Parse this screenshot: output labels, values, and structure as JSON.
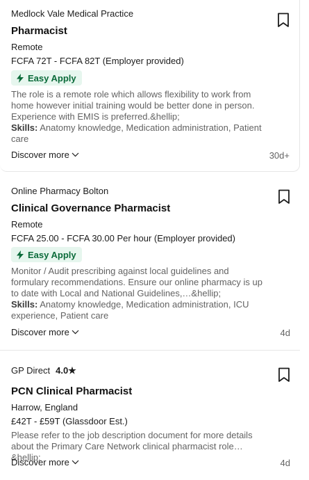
{
  "jobs": [
    {
      "company": "Medlock Vale Medical Practice",
      "rating": "",
      "title": "Pharmacist",
      "location": "Remote",
      "salary": "FCFA 72T - FCFA 82T (Employer provided)",
      "easy_apply": "Easy Apply",
      "description": "The role is a remote role which allows flexibility to work from home however initial training would be better done in person. Experience with EMIS is preferred.&hellip;",
      "skills_label": "Skills:",
      "skills": " Anatomy knowledge, Medication administration, Patient care",
      "discover": "Discover more",
      "age": "30d+"
    },
    {
      "company": "Online Pharmacy Bolton",
      "rating": "",
      "title": "Clinical Governance Pharmacist",
      "location": "Remote",
      "salary": "FCFA 25.00 - FCFA 30.00 Per hour (Employer provided)",
      "easy_apply": "Easy Apply",
      "description": "Monitor / Audit prescribing against local guidelines and formulary recommendations. Ensure our online pharmacy is up to date with Local and National Guidelines,…&hellip;",
      "skills_label": "Skills:",
      "skills": " Anatomy knowledge, Medication administration, ICU experience, Patient care",
      "discover": "Discover more",
      "age": "4d"
    },
    {
      "company": "GP Direct",
      "rating": "4.0★",
      "title": "PCN Clinical Pharmacist",
      "location": "Harrow, England",
      "salary": "£42T - £59T (Glassdoor Est.)",
      "description": "Please refer to the job description document for more details about the Primary Care Network clinical pharmacist role…&hellip;",
      "discover": "Discover more",
      "age": "4d"
    }
  ],
  "icons": {
    "bookmark": "bookmark-icon",
    "easy_apply": "lightning-icon",
    "discover": "chevron-down-icon"
  },
  "colors": {
    "easy_apply_bg": "#e6f6ee",
    "easy_apply_text": "#0b6b3a"
  }
}
